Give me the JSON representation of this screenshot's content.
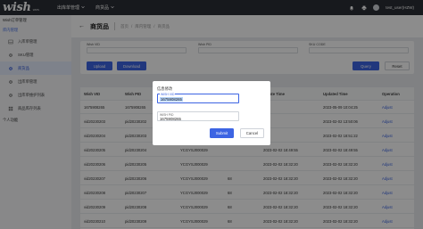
{
  "header": {
    "logo": "wish",
    "logo_sub": "WMS",
    "tabs": [
      {
        "label": "出库单管理",
        "icon": "chevron-down-icon"
      },
      {
        "label": "商货品",
        "icon": "chevron-down-icon"
      }
    ],
    "user": "test_user(HZW)"
  },
  "sidebar": {
    "groups": [
      {
        "label": "Wish订单管理"
      },
      {
        "label": "库内管理"
      },
      {
        "label": "个人功能"
      }
    ],
    "items": [
      {
        "label": "入库单管理",
        "icon": "inbox-icon"
      },
      {
        "label": "SKU管理",
        "icon": "gear-icon"
      },
      {
        "label": "商货品",
        "icon": "gear-icon"
      },
      {
        "label": "出库单管理",
        "icon": "gear-icon"
      },
      {
        "label": "出库单维护列表",
        "icon": "gear-icon"
      },
      {
        "label": "商品库存列表",
        "icon": "grid-icon"
      }
    ]
  },
  "breadcrumb": {
    "back": "←",
    "title": "商货品",
    "path": [
      "首页",
      "/",
      "库内管理",
      "/",
      "商货品"
    ]
  },
  "filter": {
    "fields": [
      {
        "label": "Wish VID",
        "value": ""
      },
      {
        "label": "Wish PID",
        "value": ""
      },
      {
        "label": "SKU CODE",
        "value": ""
      }
    ],
    "upload": "Upload",
    "download": "Download",
    "query": "Query",
    "reset": "Reset"
  },
  "table": {
    "columns": [
      "Wish VID",
      "Wish PID",
      "SKU Code",
      "Qty",
      "Create Time",
      "Updated Time",
      "Operation"
    ],
    "rows": [
      [
        "1675908265",
        "1675908265",
        "",
        "",
        "",
        "2023-05-09 10:04:25",
        "Adjust"
      ],
      [
        "vid20230203",
        "pid20230202",
        "",
        "",
        "",
        "2023-02-02 13:50:06",
        "Adjust"
      ],
      [
        "vid20230204",
        "pid20230203",
        "",
        "",
        "",
        "2023-02-02 18:51:22",
        "Adjust"
      ],
      [
        "vid20230205",
        "pid20230204",
        "YCGYSJ000029",
        "",
        "2023-02-02 18:49:55",
        "2023-02-02 18:49:55",
        "Adjust"
      ],
      [
        "vid20230206",
        "pid20230205",
        "YCGYSJ000029",
        "",
        "2023-02-02 18:32:20",
        "2023-02-02 18:32:20",
        "Adjust"
      ],
      [
        "vid20230207",
        "pid20230206",
        "YCGYSJ000029",
        "68",
        "2023-02-02 18:32:20",
        "2023-02-02 18:32:20",
        "Adjust"
      ],
      [
        "vid20230208",
        "pid20230207",
        "YCGYSJ000029",
        "68",
        "2023-02-02 18:32:20",
        "2023-02-02 18:32:20",
        "Adjust"
      ],
      [
        "vid20230209",
        "pid20230208",
        "YCGYSJ000029",
        "68",
        "2023-02-02 18:32:20",
        "2023-02-02 18:32:20",
        "Adjust"
      ],
      [
        "vid20230210",
        "pid20230209",
        "YCGYSJ000029",
        "68",
        "2023-02-02 18:32:20",
        "2023-02-02 18:32:20",
        "Adjust"
      ]
    ]
  },
  "modal": {
    "title": "信息修改",
    "vid_label": "WISH VID",
    "vid_value": "1675908265",
    "pid_label": "WISH PID",
    "pid_value": "1675908265",
    "submit": "Submit",
    "cancel": "Cancel"
  }
}
